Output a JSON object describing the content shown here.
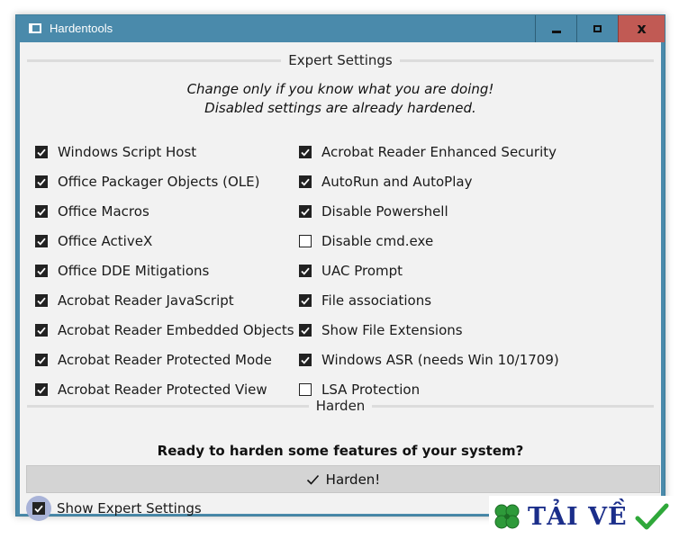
{
  "window": {
    "title": "Hardentools",
    "close_glyph": "x"
  },
  "expert": {
    "header": "Expert Settings",
    "note_line1": "Change only if you know what you are doing!",
    "note_line2": "Disabled settings are already hardened.",
    "left_items": [
      {
        "label": "Windows Script Host",
        "checked": true
      },
      {
        "label": "Office Packager Objects (OLE)",
        "checked": true
      },
      {
        "label": "Office Macros",
        "checked": true
      },
      {
        "label": "Office ActiveX",
        "checked": true
      },
      {
        "label": "Office DDE Mitigations",
        "checked": true
      },
      {
        "label": "Acrobat Reader JavaScript",
        "checked": true
      },
      {
        "label": "Acrobat Reader Embedded Objects",
        "checked": true
      },
      {
        "label": "Acrobat Reader Protected Mode",
        "checked": true
      },
      {
        "label": "Acrobat Reader Protected View",
        "checked": true
      }
    ],
    "right_items": [
      {
        "label": "Acrobat Reader Enhanced Security",
        "checked": true
      },
      {
        "label": "AutoRun and AutoPlay",
        "checked": true
      },
      {
        "label": "Disable Powershell",
        "checked": true
      },
      {
        "label": "Disable cmd.exe",
        "checked": false
      },
      {
        "label": "UAC Prompt",
        "checked": true
      },
      {
        "label": "File associations",
        "checked": true
      },
      {
        "label": "Show File Extensions",
        "checked": true
      },
      {
        "label": "Windows ASR (needs Win 10/1709)",
        "checked": true
      },
      {
        "label": "LSA Protection",
        "checked": false
      }
    ]
  },
  "harden": {
    "header": "Harden",
    "prompt": "Ready to harden some features of your system?",
    "button_label": "Harden!",
    "button_icon": "checkmark-icon"
  },
  "show_expert": {
    "label": "Show Expert Settings",
    "checked": true
  },
  "watermark": {
    "text": "TẢI VỀ",
    "left_icon": "clover-icon",
    "right_icon": "checkmark-icon"
  },
  "colors": {
    "titlebar": "#4a8aab",
    "close_button": "#c15a54",
    "client_bg": "#f2f2f2",
    "button_bg": "#d4d4d4",
    "focus_ring": "#a9b3d8",
    "watermark_text": "#1b2e8a",
    "watermark_clover": "#2e9a3a",
    "watermark_check": "#2fa83a"
  }
}
